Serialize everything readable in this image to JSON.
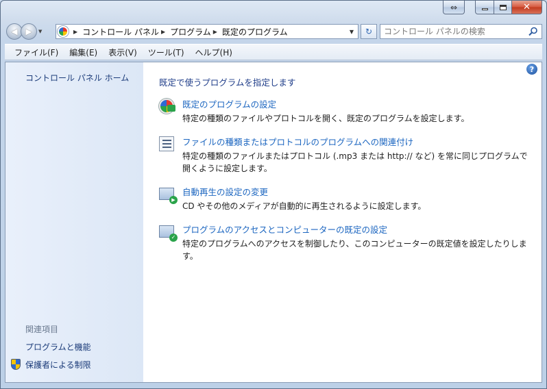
{
  "window": {
    "caption_restore_glyph": "⇔"
  },
  "nav": {
    "breadcrumbs": [
      "コントロール パネル",
      "プログラム",
      "既定のプログラム"
    ],
    "search_placeholder": "コントロール パネルの検索"
  },
  "menu": {
    "items": [
      "ファイル(F)",
      "編集(E)",
      "表示(V)",
      "ツール(T)",
      "ヘルプ(H)"
    ]
  },
  "sidebar": {
    "home_label": "コントロール パネル ホーム",
    "related_heading": "関連項目",
    "links": [
      "プログラムと機能",
      "保護者による制限"
    ]
  },
  "main": {
    "title": "既定で使うプログラムを指定します",
    "tasks": [
      {
        "link": "既定のプログラムの設定",
        "desc": "特定の種類のファイルやプロトコルを開く、既定のプログラムを設定します。",
        "icon": "default-programs-icon"
      },
      {
        "link": "ファイルの種類またはプロトコルのプログラムへの関連付け",
        "desc": "特定の種類のファイルまたはプロトコル (.mp3 または http:// など) を常に同じプログラムで開くように設定します。",
        "icon": "file-association-icon"
      },
      {
        "link": "自動再生の設定の変更",
        "desc": "CD やその他のメディアが自動的に再生されるように設定します。",
        "icon": "autoplay-icon"
      },
      {
        "link": "プログラムのアクセスとコンピューターの既定の設定",
        "desc": "特定のプログラムへのアクセスを制御したり、このコンピューターの既定値を設定したりします。",
        "icon": "program-access-icon"
      }
    ]
  },
  "colors": {
    "link": "#1c66c0",
    "title": "#1f3d89",
    "sidebar_link": "#1a3a78"
  }
}
